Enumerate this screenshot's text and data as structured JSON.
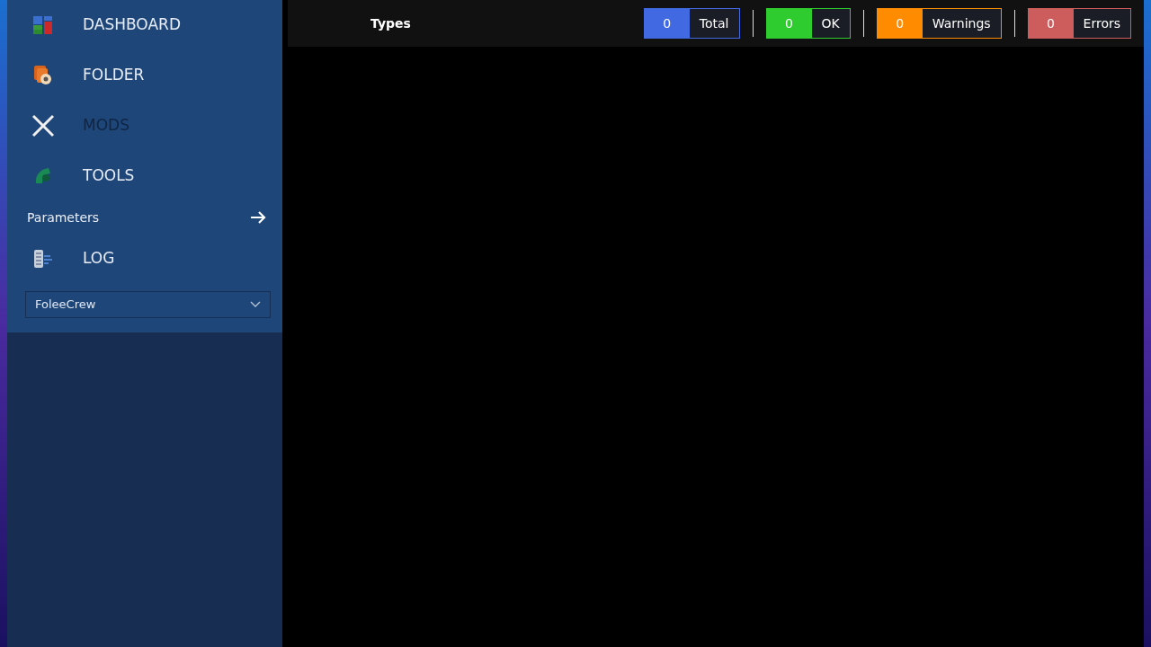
{
  "sidebar": {
    "items": [
      {
        "kind": "nav",
        "label": "DASHBOARD",
        "disabled": false
      },
      {
        "kind": "nav",
        "label": "FOLDER",
        "disabled": false
      },
      {
        "kind": "nav",
        "label": "MODS",
        "disabled": true
      },
      {
        "kind": "nav",
        "label": "TOOLS",
        "disabled": false
      },
      {
        "kind": "section",
        "label": "Parameters"
      },
      {
        "kind": "nav",
        "label": "LOG",
        "disabled": false
      }
    ],
    "dropdown": {
      "value": "FoleeCrew"
    }
  },
  "toolbar": {
    "title": "Types",
    "counters": [
      {
        "value": "0",
        "label": "Total",
        "color": "#4169e1"
      },
      {
        "value": "0",
        "label": "OK",
        "color": "#2ecc2e"
      },
      {
        "value": "0",
        "label": "Warnings",
        "color": "#ff8c00"
      },
      {
        "value": "0",
        "label": "Errors",
        "color": "#cd5c5c"
      }
    ]
  }
}
